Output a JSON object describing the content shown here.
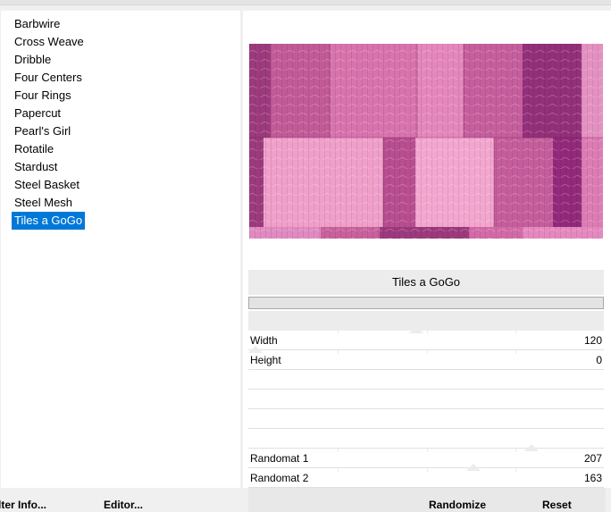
{
  "filters": {
    "items": [
      {
        "label": "Barbwire"
      },
      {
        "label": "Cross Weave"
      },
      {
        "label": "Dribble"
      },
      {
        "label": "Four Centers"
      },
      {
        "label": "Four Rings"
      },
      {
        "label": "Papercut"
      },
      {
        "label": "Pearl's Girl"
      },
      {
        "label": "Rotatile"
      },
      {
        "label": "Stardust"
      },
      {
        "label": "Steel Basket"
      },
      {
        "label": "Steel Mesh"
      },
      {
        "label": "Tiles a GoGo",
        "selected": true
      }
    ]
  },
  "settings": {
    "title": "Tiles a GoGo",
    "progress": 0,
    "sliders": [
      {
        "label": "Width",
        "value": "120",
        "level": 0.47
      },
      {
        "label": "Height",
        "value": "0",
        "level": 0.0
      },
      {
        "label": "Randomat 1",
        "value": "207",
        "level": 0.81
      },
      {
        "label": "Randomat 2",
        "value": "163",
        "level": 0.64
      }
    ]
  },
  "buttons": {
    "filter_info_label": "lter Info...",
    "editor_label": "Editor...",
    "randomize_label": "Randomize",
    "reset_label": "Reset"
  },
  "colors": {
    "selection": "#0078d7",
    "preview_dark": "#8e2a72",
    "preview_mid": "#c8619c",
    "preview_light": "#ef9cc6"
  }
}
